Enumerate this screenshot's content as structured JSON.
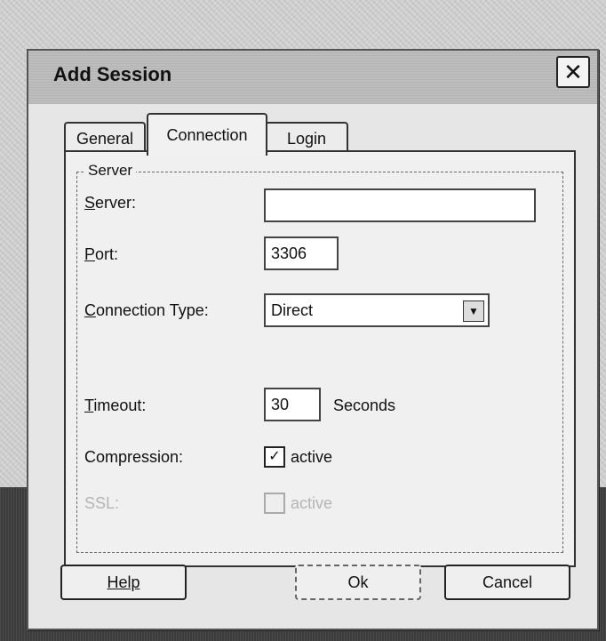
{
  "window": {
    "title": "Add Session"
  },
  "tabs": [
    {
      "label": "General",
      "active": false
    },
    {
      "label": "Connection",
      "active": true
    },
    {
      "label": "Login",
      "active": false
    }
  ],
  "group": {
    "title": "Server"
  },
  "fields": {
    "server": {
      "label_prefix": "S",
      "label_rest": "erver:",
      "value": ""
    },
    "port": {
      "label_prefix": "P",
      "label_rest": "ort:",
      "value": "3306"
    },
    "connection_type": {
      "label_prefix": "C",
      "label_rest": "onnection Type:",
      "value": "Direct"
    },
    "timeout": {
      "label_prefix": "T",
      "label_rest": "imeout:",
      "value": "30",
      "unit": "Seconds"
    },
    "compression": {
      "label": "Compression:",
      "checkbox_label": "active",
      "checked": true
    },
    "ssl": {
      "label": "SSL:",
      "checkbox_label": "active",
      "checked": false,
      "disabled": true
    }
  },
  "buttons": {
    "help": "Help",
    "ok": "Ok",
    "cancel": "Cancel"
  }
}
